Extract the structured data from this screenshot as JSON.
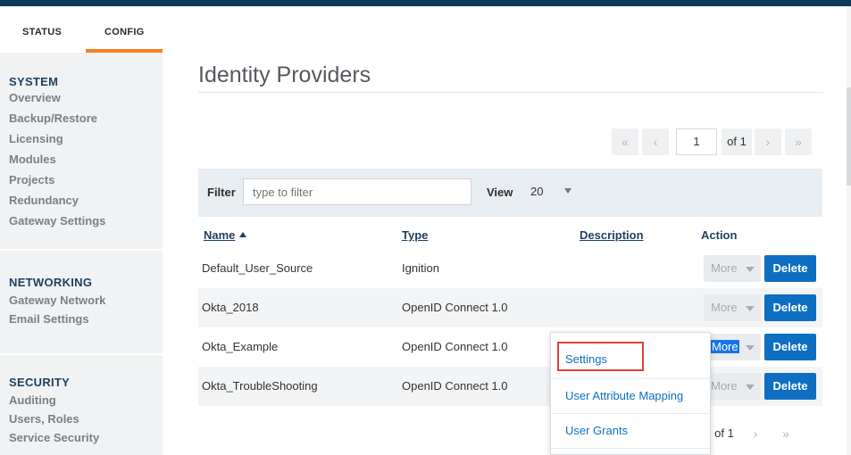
{
  "tabs": {
    "status": "STATUS",
    "config": "CONFIG"
  },
  "sidebar": {
    "system": {
      "heading": "SYSTEM",
      "items": [
        "Overview",
        "Backup/Restore",
        "Licensing",
        "Modules",
        "Projects",
        "Redundancy",
        "Gateway Settings"
      ]
    },
    "networking": {
      "heading": "NETWORKING",
      "items": [
        "Gateway Network",
        "Email Settings"
      ]
    },
    "security": {
      "heading": "SECURITY",
      "items": [
        "Auditing",
        "Users, Roles",
        "Service Security"
      ]
    }
  },
  "page": {
    "title": "Identity Providers"
  },
  "pager_top": {
    "first": "«",
    "prev": "‹",
    "page": "1",
    "of": "of 1",
    "next": "›",
    "last": "»"
  },
  "pager_bottom": {
    "of": "of 1",
    "next": "›",
    "last": "»"
  },
  "filter": {
    "label": "Filter",
    "placeholder": "type to filter",
    "view_label": "View",
    "view_value": "20"
  },
  "table": {
    "headers": {
      "name": "Name",
      "type": "Type",
      "description": "Description",
      "action": "Action"
    },
    "rows": [
      {
        "name": "Default_User_Source",
        "type": "Ignition",
        "description": ""
      },
      {
        "name": "Okta_2018",
        "type": "OpenID Connect 1.0",
        "description": ""
      },
      {
        "name": "Okta_Example",
        "type": "OpenID Connect 1.0",
        "description": ""
      },
      {
        "name": "Okta_TroubleShooting",
        "type": "OpenID Connect 1.0",
        "description": ""
      }
    ],
    "more_label": "More",
    "delete_label": "Delete"
  },
  "dropdown": {
    "items": [
      "Settings",
      "User Attribute Mapping",
      "User Grants"
    ]
  },
  "colors": {
    "accent_orange": "#f58220",
    "primary_blue": "#0e6fc2",
    "highlight_red": "#e2403a",
    "top_bar": "#0f3a5c"
  }
}
